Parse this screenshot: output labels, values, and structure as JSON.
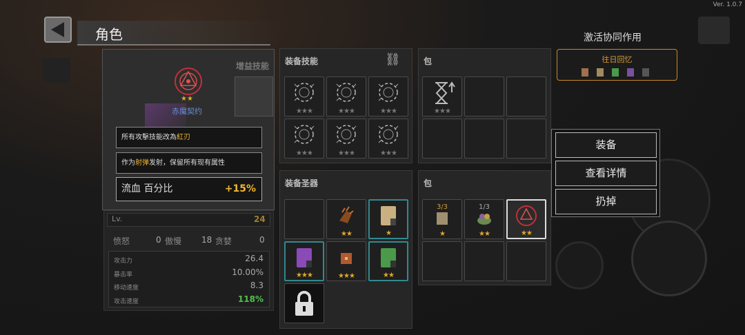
{
  "version": "Ver. 1.0.7",
  "header": {
    "title": "角色"
  },
  "synergy": {
    "title": "激活协同作用",
    "card_label": "往日回忆"
  },
  "left_panel": {
    "buff_title": "增益技能"
  },
  "item": {
    "name": "赤魔契约",
    "stars": "★★"
  },
  "tooltip": {
    "line1_prefix": "所有攻擊技能改為",
    "line1_highlight": "紅刃",
    "line2_prefix": "作为",
    "line2_highlight": "射弹",
    "line2_suffix": "发射，保留所有现有属性",
    "stat_name": "流血 百分比",
    "stat_value": "+15%"
  },
  "level": {
    "label": "Lv.",
    "value": "24"
  },
  "sins": [
    {
      "label": "愤怒",
      "value": "0"
    },
    {
      "label": "傲慢",
      "value": "18"
    },
    {
      "label": "贪婪",
      "value": "0"
    }
  ],
  "stats": [
    {
      "label": "攻击力",
      "value": "26.4"
    },
    {
      "label": "暴击率",
      "value": "10.00%"
    },
    {
      "label": "移动速度",
      "value": "8.3"
    },
    {
      "label": "攻击速度",
      "value": "118%"
    }
  ],
  "skills_panel": {
    "title": "装备技能",
    "stars": "★★★"
  },
  "bag1": {
    "title": "包",
    "stars": "★★★"
  },
  "relics_panel": {
    "title": "装备圣器",
    "stars": [
      "★★",
      "★",
      "★★★",
      "★★★",
      "★★"
    ]
  },
  "bag2": {
    "title": "包",
    "counts": [
      "3/3",
      "1/3"
    ],
    "stars": [
      "★",
      "★★",
      "★★"
    ]
  },
  "menu": {
    "equip": "装备",
    "details": "查看详情",
    "drop": "扔掉"
  },
  "colors": {
    "gold": "#f2b632",
    "teal": "#2f8a8f",
    "green": "#4fc24f",
    "orange_border": "#c98a2a"
  }
}
